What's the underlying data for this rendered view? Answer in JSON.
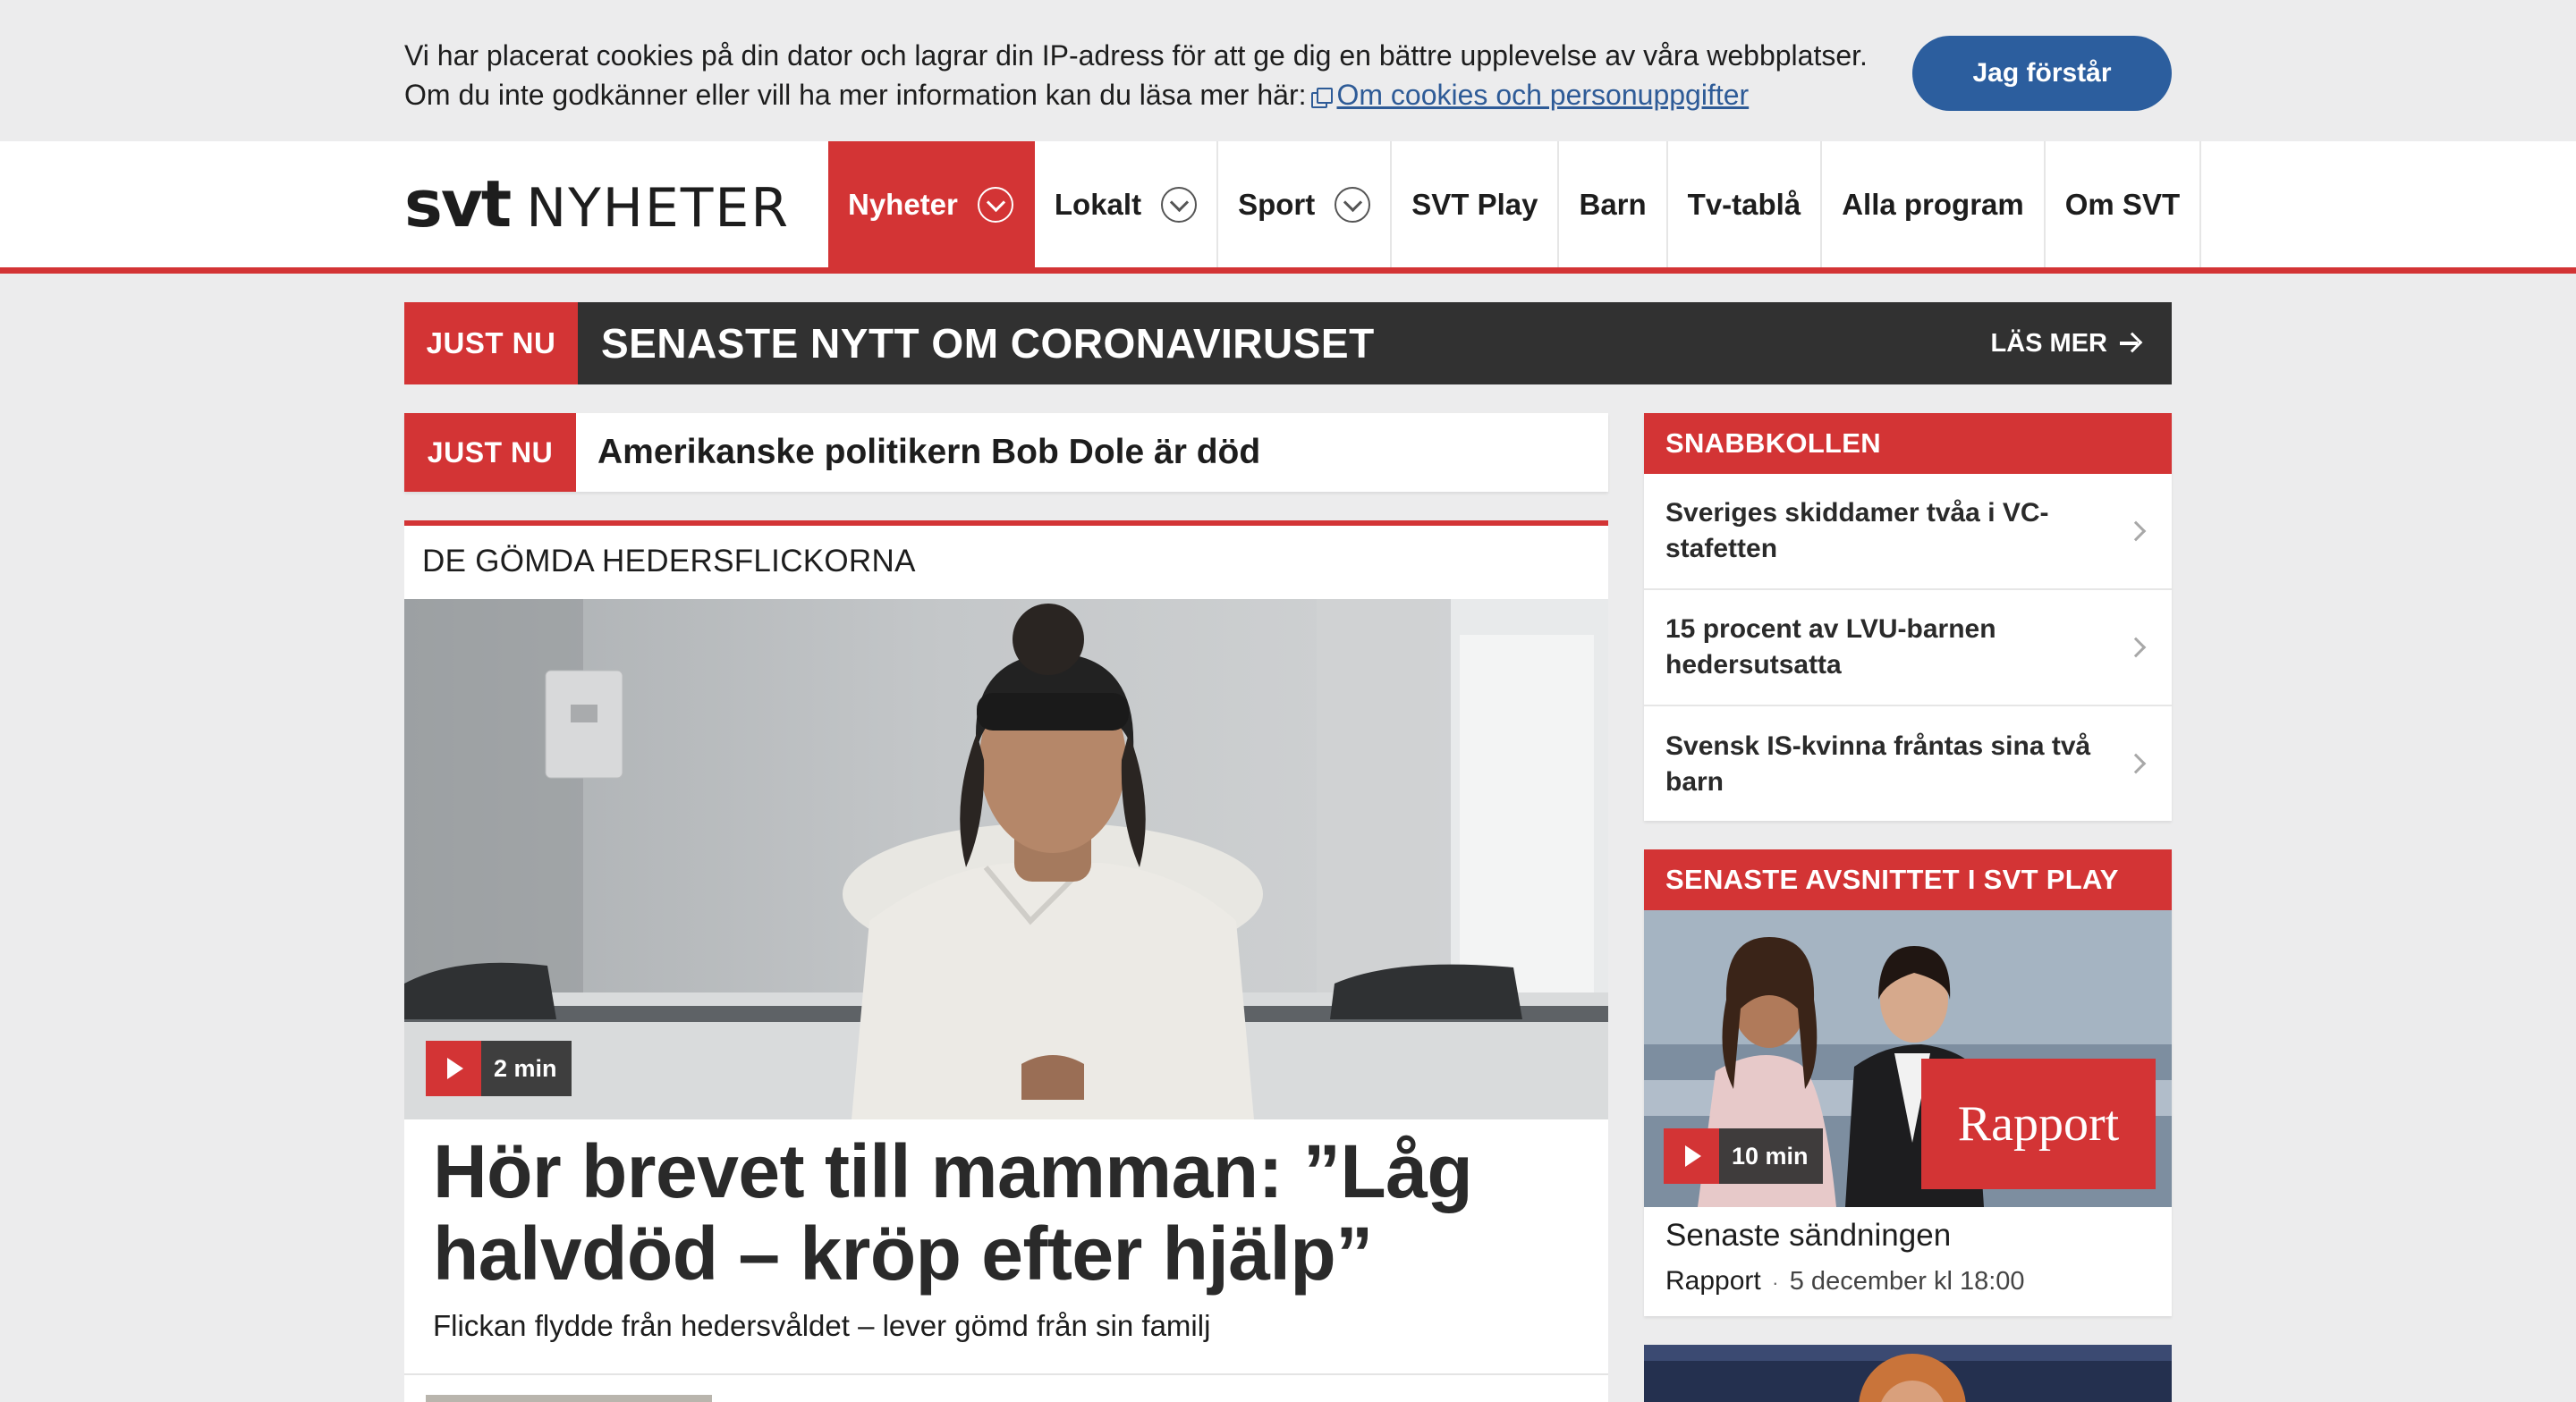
{
  "cookie": {
    "line1": "Vi har placerat cookies på din dator och lagrar din IP-adress för att ge dig en bättre upplevelse av våra webbplatser.",
    "line2": "Om du inte godkänner eller vill ha mer information kan du läsa mer här:",
    "link": "Om cookies och personuppgifter",
    "button": "Jag förstår"
  },
  "header": {
    "logo_svt": "svt",
    "logo_section": "NYHETER",
    "nav": [
      {
        "label": "Nyheter",
        "dropdown": true,
        "active": true
      },
      {
        "label": "Lokalt",
        "dropdown": true
      },
      {
        "label": "Sport",
        "dropdown": true
      },
      {
        "label": "SVT Play"
      },
      {
        "label": "Barn"
      },
      {
        "label": "Tv-tablå"
      },
      {
        "label": "Alla program"
      },
      {
        "label": "Om SVT"
      }
    ]
  },
  "banner": {
    "tag": "JUST NU",
    "title": "SENASTE NYTT OM CORONAVIRUSET",
    "more": "LÄS MER"
  },
  "breaking": {
    "tag": "JUST NU",
    "title": "Amerikanske politikern Bob Dole är död"
  },
  "article": {
    "kicker": "DE GÖMDA HEDERSFLICKORNA",
    "video_duration": "2 min",
    "headline": "Hör brevet till mamman: ”Låg halvdöd – kröp efter hjälp”",
    "subline": "Flickan flydde från hedersvåldet – lever gömd från sin familj"
  },
  "snabbkollen": {
    "title": "SNABBKOLLEN",
    "items": [
      "Sveriges skiddamer tvåa i VC-stafetten",
      "15 procent av LVU-barnen hedersutsatta",
      "Svensk IS-kvinna fråntas sina två barn"
    ]
  },
  "svtplay": {
    "title": "SENASTE AVSNITTET I SVT PLAY",
    "program_logo": "Rapport",
    "duration": "10 min",
    "episode": "Senaste sändningen",
    "program": "Rapport",
    "separator": "·",
    "date": "5 december kl 18:00"
  },
  "colors": {
    "brand_red": "#d33435",
    "dark_bar": "#313131",
    "cookie_button": "#2c5e9e",
    "link": "#2e5b97"
  }
}
